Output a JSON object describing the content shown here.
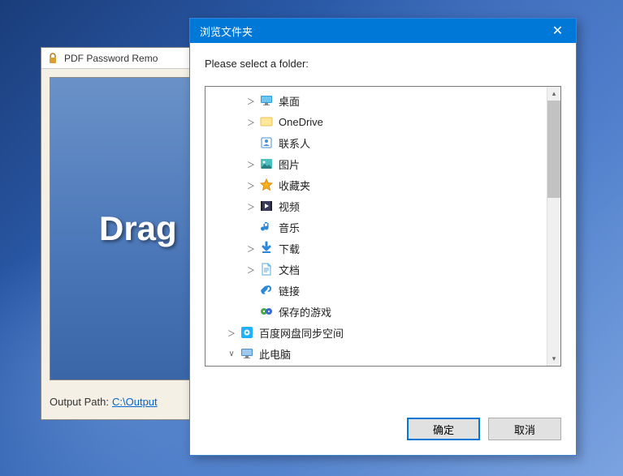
{
  "parent": {
    "title": "PDF Password Remo",
    "drag_label": "Drag",
    "output_label": "Output Path:",
    "output_path": "C:\\Output"
  },
  "dialog": {
    "title": "浏览文件夹",
    "instruction": "Please select a folder:",
    "ok_label": "确定",
    "cancel_label": "取消"
  },
  "tree": [
    {
      "level": 2,
      "expander": "＞",
      "icon": "desktop",
      "label": "桌面"
    },
    {
      "level": 2,
      "expander": "＞",
      "icon": "onedrive",
      "label": "OneDrive"
    },
    {
      "level": 2,
      "expander": "",
      "icon": "contacts",
      "label": "联系人"
    },
    {
      "level": 2,
      "expander": "＞",
      "icon": "pictures",
      "label": "图片"
    },
    {
      "level": 2,
      "expander": "＞",
      "icon": "favorites",
      "label": "收藏夹"
    },
    {
      "level": 2,
      "expander": "＞",
      "icon": "videos",
      "label": "视频"
    },
    {
      "level": 2,
      "expander": "",
      "icon": "music",
      "label": "音乐"
    },
    {
      "level": 2,
      "expander": "＞",
      "icon": "downloads",
      "label": "下载"
    },
    {
      "level": 2,
      "expander": "＞",
      "icon": "documents",
      "label": "文档"
    },
    {
      "level": 2,
      "expander": "",
      "icon": "links",
      "label": "链接"
    },
    {
      "level": 2,
      "expander": "",
      "icon": "games",
      "label": "保存的游戏"
    },
    {
      "level": 1,
      "expander": "＞",
      "icon": "baidu",
      "label": "百度网盘同步空间"
    },
    {
      "level": 1,
      "expander": "∨",
      "icon": "thispc",
      "label": "此电脑"
    }
  ]
}
